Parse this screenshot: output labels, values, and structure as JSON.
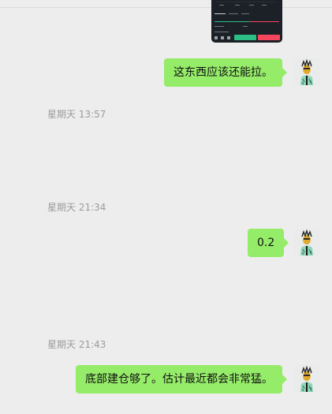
{
  "chat": {
    "image_message": {
      "kind": "trading-app-screenshot",
      "buy_color": "#2ebd85",
      "sell_color": "#f6465d"
    },
    "messages": [
      {
        "type": "outgoing",
        "text": "这东西应该还能拉。"
      },
      {
        "type": "timestamp",
        "text": "星期天 13:57"
      },
      {
        "type": "timestamp",
        "text": "星期天 21:34"
      },
      {
        "type": "outgoing",
        "text": "0.2"
      },
      {
        "type": "timestamp",
        "text": "星期天 21:43"
      },
      {
        "type": "outgoing",
        "text": "底部建仓够了。估计最近都会非常猛。"
      }
    ],
    "bubble_color": "#95ec69",
    "background_color": "#ededed"
  }
}
